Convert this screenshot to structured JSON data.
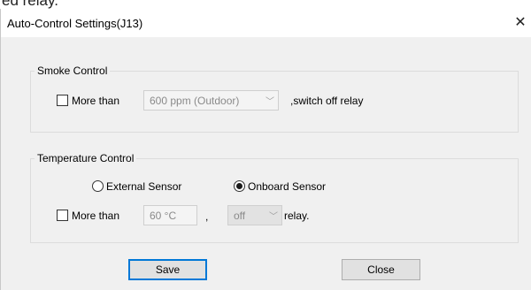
{
  "window": {
    "title": "Auto-Control Settings(J13)",
    "close_glyph": "✕",
    "bg_fragment": "ed relay."
  },
  "smoke": {
    "legend": "Smoke Control",
    "checkbox_label": "More than",
    "checked": false,
    "ppm_value": "600 ppm (Outdoor)",
    "suffix": ",switch off relay"
  },
  "temperature": {
    "legend": "Temperature Control",
    "radio_external": "External Sensor",
    "radio_onboard": "Onboard Sensor",
    "selected_sensor": "Onboard Sensor",
    "checkbox_label": "More than",
    "checked": false,
    "temp_value": "60 °C",
    "comma": ",",
    "relay_state": "off",
    "relay_suffix": "relay."
  },
  "buttons": {
    "save": "Save",
    "close": "Close"
  },
  "icons": {
    "chevron": "chevron-down-icon",
    "close": "close-icon"
  }
}
